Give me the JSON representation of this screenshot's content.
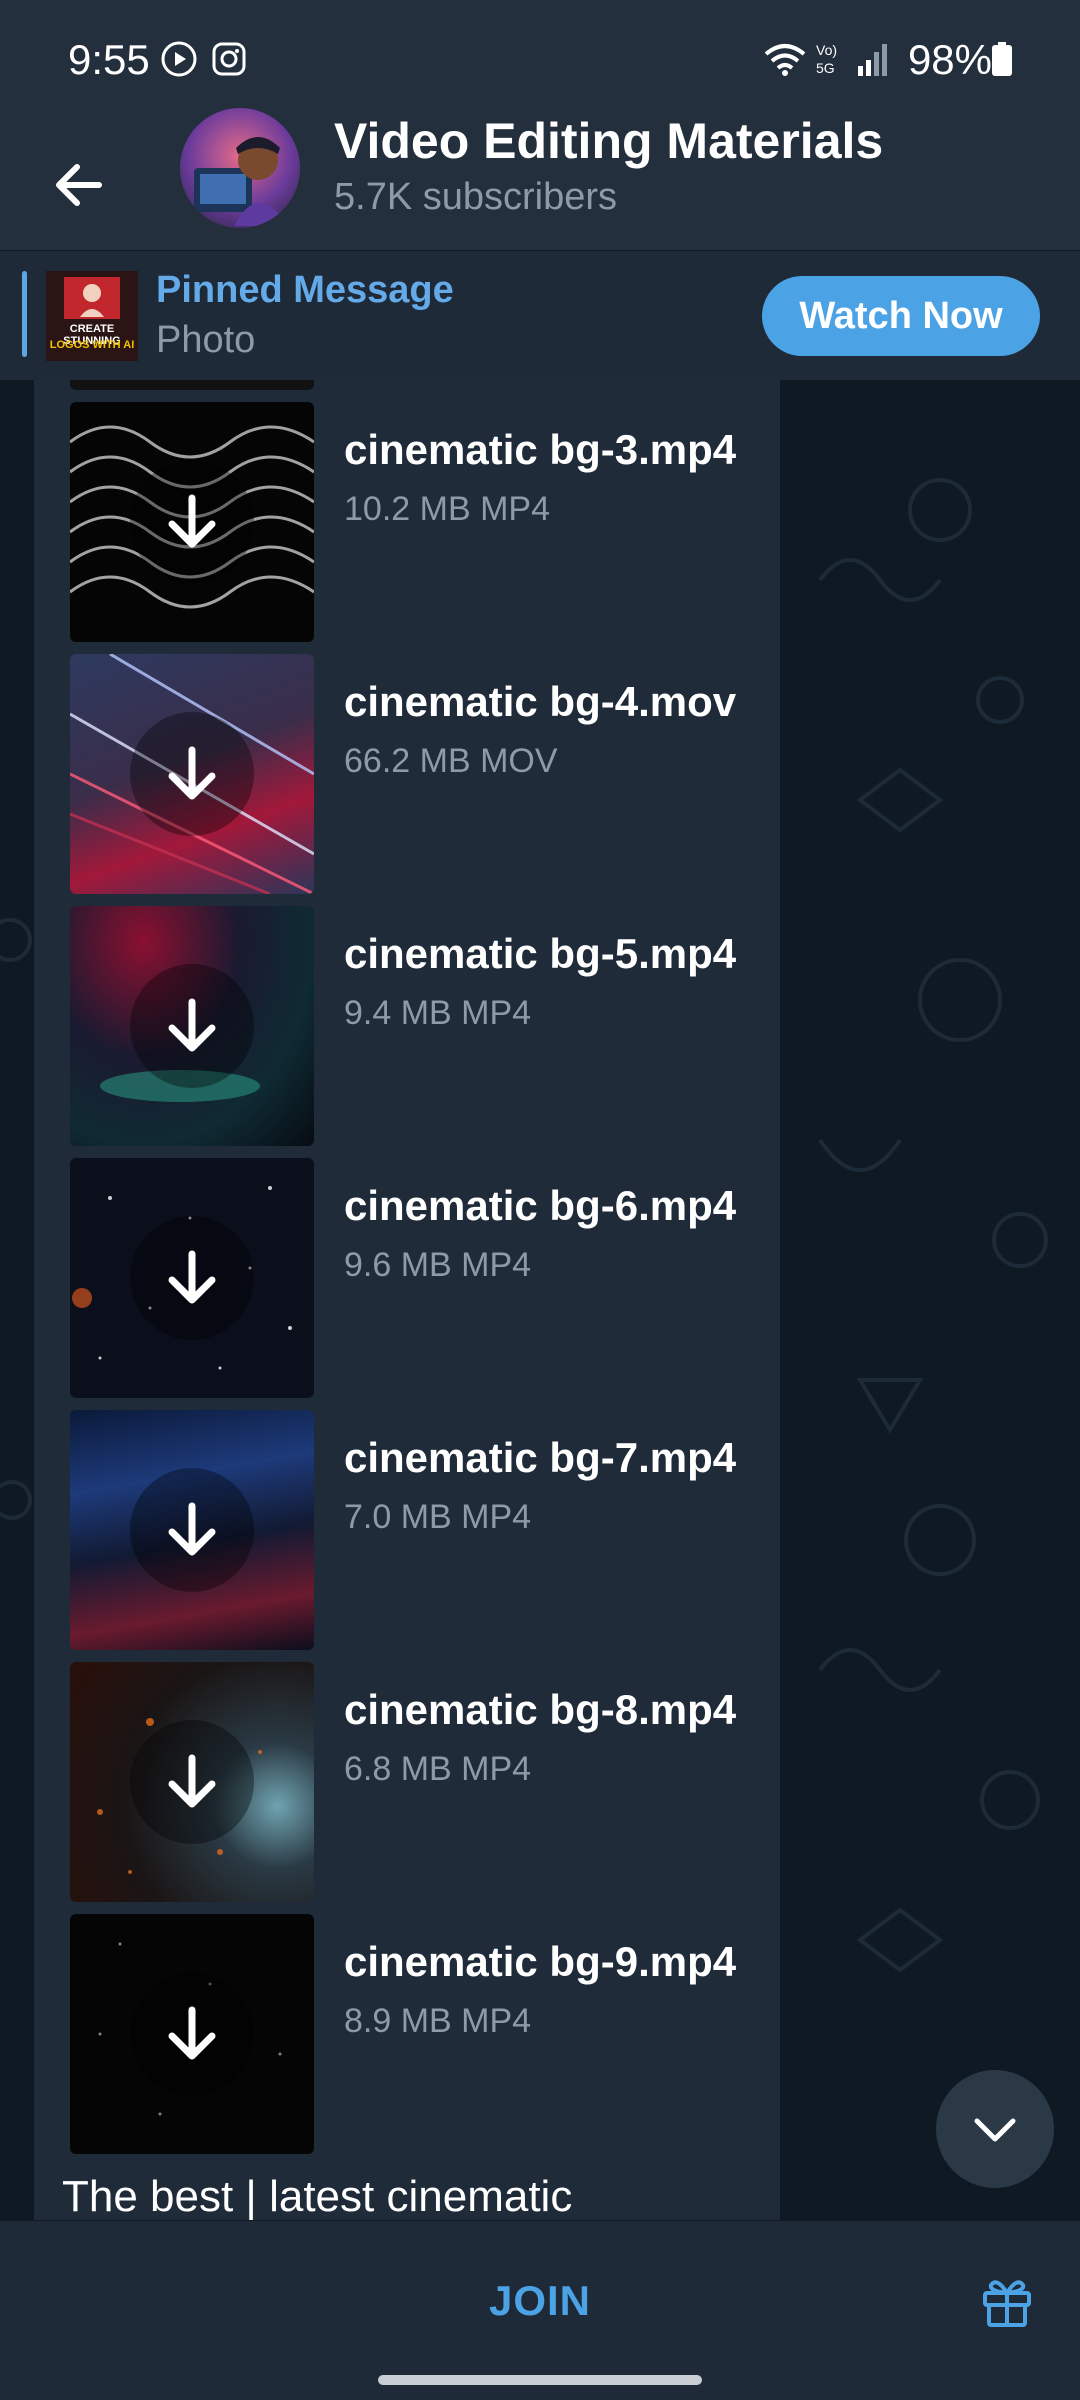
{
  "status_bar": {
    "time": "9:55",
    "battery": "98%",
    "icons": [
      "media-play-icon",
      "instagram-icon",
      "wifi-icon",
      "volte-5g-icon",
      "signal-icon",
      "battery-icon"
    ]
  },
  "header": {
    "title": "Video Editing Materials",
    "subscribers": "5.7K subscribers",
    "back_icon": "back-arrow-icon",
    "menu_icon": "more-vertical-icon"
  },
  "pinned": {
    "title": "Pinned Message",
    "subtitle": "Photo",
    "thumb_text_1": "CREATE STUNNING",
    "thumb_text_2": "LOGOS WITH AI",
    "action_label": "Watch Now"
  },
  "files": [
    {
      "name": "cinematic bg-3.mp4",
      "meta": "10.2 MB MP4"
    },
    {
      "name": "cinematic bg-4.mov",
      "meta": "66.2 MB MOV"
    },
    {
      "name": "cinematic bg-5.mp4",
      "meta": "9.4 MB MP4"
    },
    {
      "name": "cinematic bg-6.mp4",
      "meta": "9.6 MB MP4"
    },
    {
      "name": "cinematic bg-7.mp4",
      "meta": "7.0 MB MP4"
    },
    {
      "name": "cinematic bg-8.mp4",
      "meta": "6.8 MB MP4"
    },
    {
      "name": "cinematic bg-9.mp4",
      "meta": "8.9 MB MP4"
    }
  ],
  "caption": "The best | latest cinematic",
  "bottom": {
    "join_label": "JOIN",
    "gift_icon": "gift-icon"
  },
  "colors": {
    "accent": "#4ba3e6",
    "header_bg": "#232f3c",
    "chat_bg": "#0f1923",
    "bubble_bg": "#1f2b38",
    "secondary_text": "#8d9aa7"
  }
}
